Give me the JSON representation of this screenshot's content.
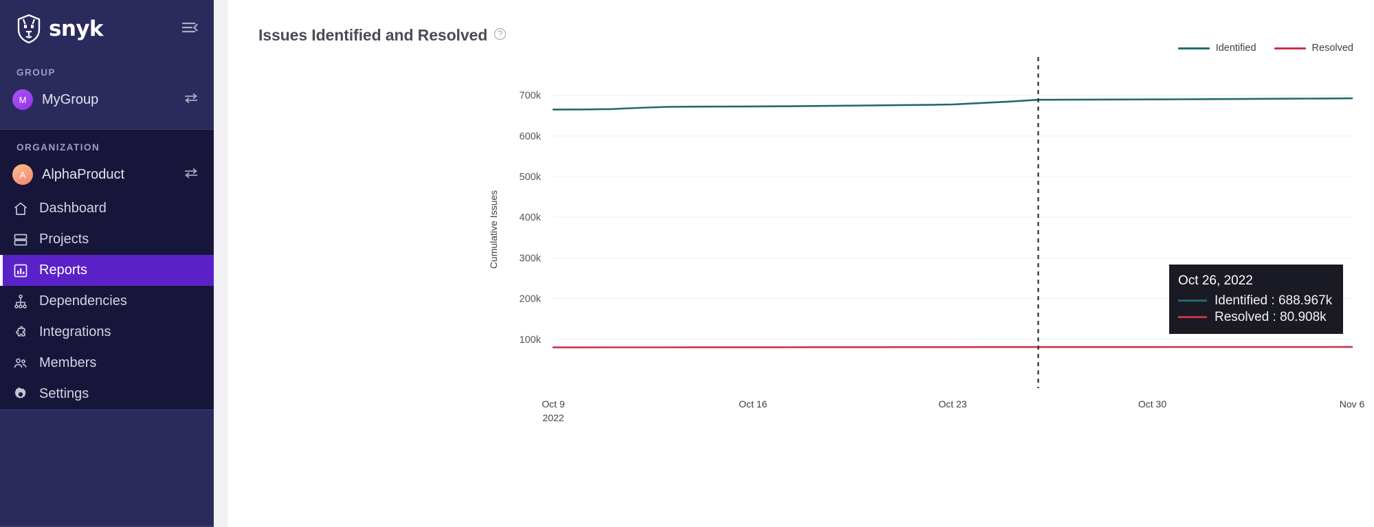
{
  "sidebar": {
    "brand": {
      "name": "snyk",
      "logo_icon": "snyk-wolf-logo",
      "collapse_icon": "collapse-sidebar-icon"
    },
    "group": {
      "label": "GROUP",
      "name": "MyGroup",
      "avatar_initial": "M",
      "avatar_color": "#a855f7",
      "switch_icon": "switch-arrows-icon"
    },
    "organization": {
      "label": "ORGANIZATION",
      "name": "AlphaProduct",
      "avatar_initial": "A",
      "avatar_color": "#f4846e",
      "switch_icon": "switch-arrows-icon"
    },
    "nav": [
      {
        "label": "Dashboard",
        "icon": "home-icon",
        "active": false
      },
      {
        "label": "Projects",
        "icon": "projects-icon",
        "active": false
      },
      {
        "label": "Reports",
        "icon": "reports-bar-icon",
        "active": true
      },
      {
        "label": "Dependencies",
        "icon": "dependencies-icon",
        "active": false
      },
      {
        "label": "Integrations",
        "icon": "puzzle-icon",
        "active": false
      },
      {
        "label": "Members",
        "icon": "members-icon",
        "active": false
      },
      {
        "label": "Settings",
        "icon": "gear-icon",
        "active": false
      }
    ],
    "active_color": "#5b21c9",
    "background_color": "#17163a",
    "header_background_color": "#2b2a5c"
  },
  "main": {
    "title": "Issues Identified and Resolved",
    "help_icon": "question-mark-circle-icon"
  },
  "tooltip": {
    "date": "Oct 26, 2022",
    "rows": [
      {
        "label": "Identified : 688.967k",
        "color": "#1f6b6b"
      },
      {
        "label": "Resolved : 80.908k",
        "color": "#c9324b"
      }
    ]
  },
  "chart_data": {
    "type": "line",
    "title": "Issues Identified and Resolved",
    "xlabel": "",
    "ylabel": "Cumulative Issues",
    "grid": true,
    "legend_position": "top-right",
    "ylim": [
      0,
      740000
    ],
    "ytick_labels": [
      "100k",
      "200k",
      "300k",
      "400k",
      "500k",
      "600k",
      "700k"
    ],
    "ytick_values": [
      100000,
      200000,
      300000,
      400000,
      500000,
      600000,
      700000
    ],
    "xtick_labels": [
      "Oct 9",
      "Oct 16",
      "Oct 23",
      "Oct 30",
      "Nov 6"
    ],
    "xtick_sublabel": "2022",
    "x": [
      "Oct 9",
      "Oct 10",
      "Oct 11",
      "Oct 12",
      "Oct 13",
      "Oct 14",
      "Oct 15",
      "Oct 16",
      "Oct 17",
      "Oct 18",
      "Oct 19",
      "Oct 20",
      "Oct 21",
      "Oct 22",
      "Oct 23",
      "Oct 24",
      "Oct 25",
      "Oct 26",
      "Oct 27",
      "Oct 28",
      "Oct 29",
      "Oct 30",
      "Oct 31",
      "Nov 1",
      "Nov 2",
      "Nov 3",
      "Nov 4",
      "Nov 5",
      "Nov 6"
    ],
    "series": [
      {
        "name": "Identified",
        "color": "#1f6b6b",
        "values": [
          665000,
          665200,
          666000,
          669000,
          671500,
          672000,
          672300,
          672600,
          673000,
          673600,
          674200,
          674900,
          675600,
          676300,
          677500,
          681000,
          684500,
          688967,
          689200,
          689400,
          689600,
          689900,
          690200,
          690500,
          690900,
          691300,
          691700,
          692100,
          692500
        ]
      },
      {
        "name": "Resolved",
        "color": "#c9324b",
        "values": [
          80100,
          80150,
          80200,
          80250,
          80300,
          80350,
          80400,
          80450,
          80500,
          80550,
          80600,
          80650,
          80700,
          80750,
          80800,
          80850,
          80880,
          80908,
          80930,
          80950,
          80970,
          81000,
          81030,
          81060,
          81090,
          81120,
          81150,
          81180,
          81200
        ]
      }
    ],
    "cursor": {
      "x_label": "Oct 26, 2022",
      "style": "dashed-vertical"
    },
    "legend": [
      {
        "label": "Identified",
        "color": "#1f6b6b"
      },
      {
        "label": "Resolved",
        "color": "#c9324b"
      }
    ]
  }
}
